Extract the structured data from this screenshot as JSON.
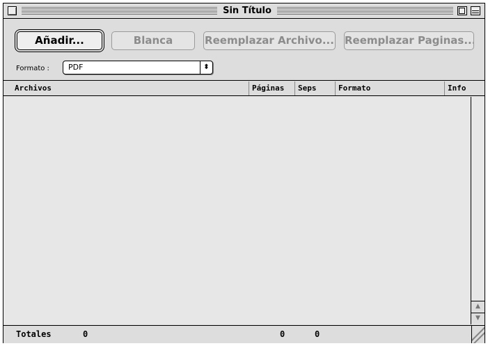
{
  "window": {
    "title": "Sin Título"
  },
  "toolbar": {
    "add_label": "Añadir...",
    "blank_label": "Blanca",
    "replace_file_label": "Reemplazar Archivo...",
    "replace_pages_label": "Reemplazar Paginas...",
    "format_label": "Formato :",
    "format_value": "PDF",
    "format_arrows": "⬍"
  },
  "columns": {
    "archivos": "Archivos",
    "paginas": "Páginas",
    "seps": "Seps",
    "formato": "Formato",
    "info": "Info"
  },
  "totals": {
    "label": "Totales",
    "files": "0",
    "pages": "0",
    "seps": "0"
  },
  "scrollbar": {
    "up": "▲",
    "down": "▼"
  }
}
